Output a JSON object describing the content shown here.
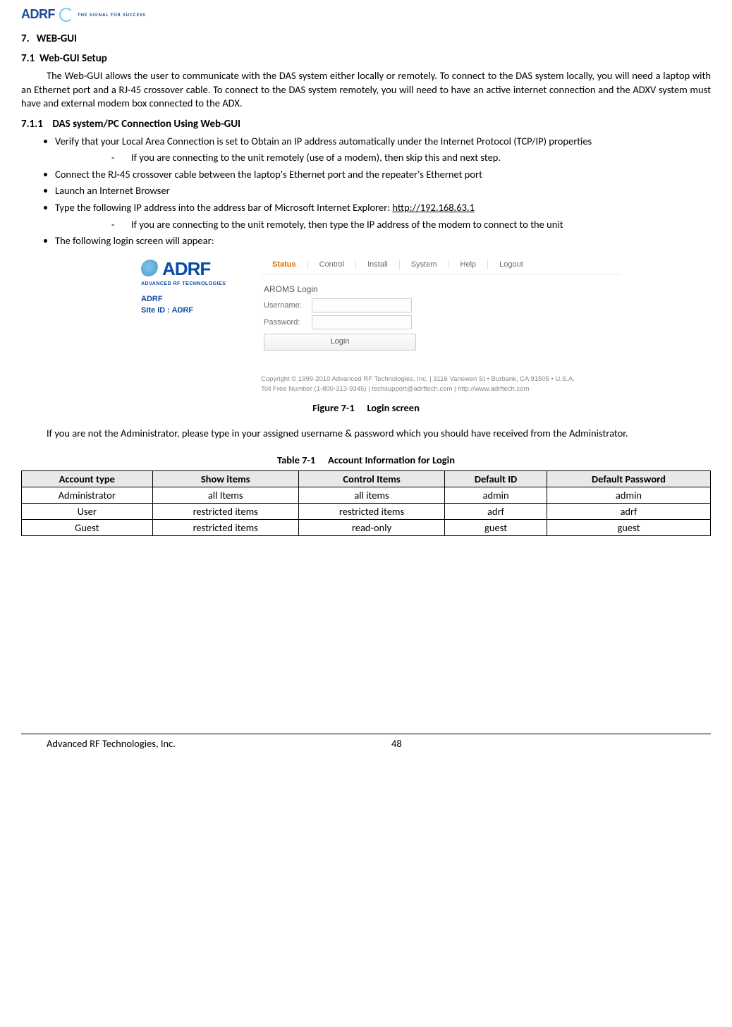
{
  "header": {
    "logo_text": "ADRF",
    "tagline": "THE SIGNAL FOR SUCCESS"
  },
  "sections": {
    "h1_num": "7.",
    "h1_title": "WEB-GUI",
    "h2_num": "7.1",
    "h2_title": "Web-GUI Setup",
    "intro": "The Web-GUI allows the user to communicate with the DAS system either locally or remotely.  To connect to the DAS system locally, you will need a laptop with an Ethernet port and a RJ-45 crossover cable.  To connect to the DAS system remotely, you will need to have an active internet connection and the ADXV system must have and external modem box connected to the ADX.",
    "h3_num": "7.1.1",
    "h3_title": "DAS system/PC Connection Using Web-GUI",
    "bullets": {
      "b1": "Verify that your Local Area Connection is set to Obtain an IP address automatically under the Internet Protocol (TCP/IP) properties",
      "b1_dash": "If you are connecting to the unit remotely (use of a modem), then skip this and next step.",
      "b2": "Connect the RJ-45 crossover cable between the laptop's Ethernet port and the repeater's Ethernet port",
      "b3": "Launch an Internet Browser",
      "b4_pre": "Type the following IP address into the address bar of Microsoft Internet Explorer: ",
      "b4_url": "http://192.168.63.1",
      "b4_dash": "If you are connecting to the unit remotely, then type the IP address of the modem to connect to the unit",
      "b5": "The following login screen will appear:"
    }
  },
  "login_screenshot": {
    "logo_text": "ADRF",
    "logo_sub": "ADVANCED RF TECHNOLOGIES",
    "id_line1": "ADRF",
    "id_line2": "Site ID : ADRF",
    "tabs": [
      "Status",
      "Control",
      "Install",
      "System",
      "Help",
      "Logout"
    ],
    "active_tab_index": 0,
    "form": {
      "title": "AROMS Login",
      "username_label": "Username:",
      "password_label": "Password:",
      "button": "Login"
    },
    "footer_line1": "Copyright © 1999-2010 Advanced RF Technologies, Inc. | 3116 Vanowen St • Burbank, CA 91505 • U.S.A.",
    "footer_line2": "Toll Free Number (1-800-313-9345) | techsupport@adrftech.com | http://www.adrftech.com"
  },
  "figure_caption": "Figure 7-1  Login screen",
  "post_figure": "If you are not the Administrator, please type in your assigned username & password which you should have received from the Administrator.",
  "table_caption": "Table 7-1  Account Information for Login",
  "table": {
    "headers": [
      "Account type",
      "Show items",
      "Control Items",
      "Default ID",
      "Default Password"
    ],
    "rows": [
      [
        "Administrator",
        "all Items",
        "all items",
        "admin",
        "admin"
      ],
      [
        "User",
        "restricted items",
        "restricted items",
        "adrf",
        "adrf"
      ],
      [
        "Guest",
        "restricted items",
        "read-only",
        "guest",
        "guest"
      ]
    ]
  },
  "footer": {
    "company": "Advanced RF Technologies, Inc.",
    "page": "48"
  }
}
